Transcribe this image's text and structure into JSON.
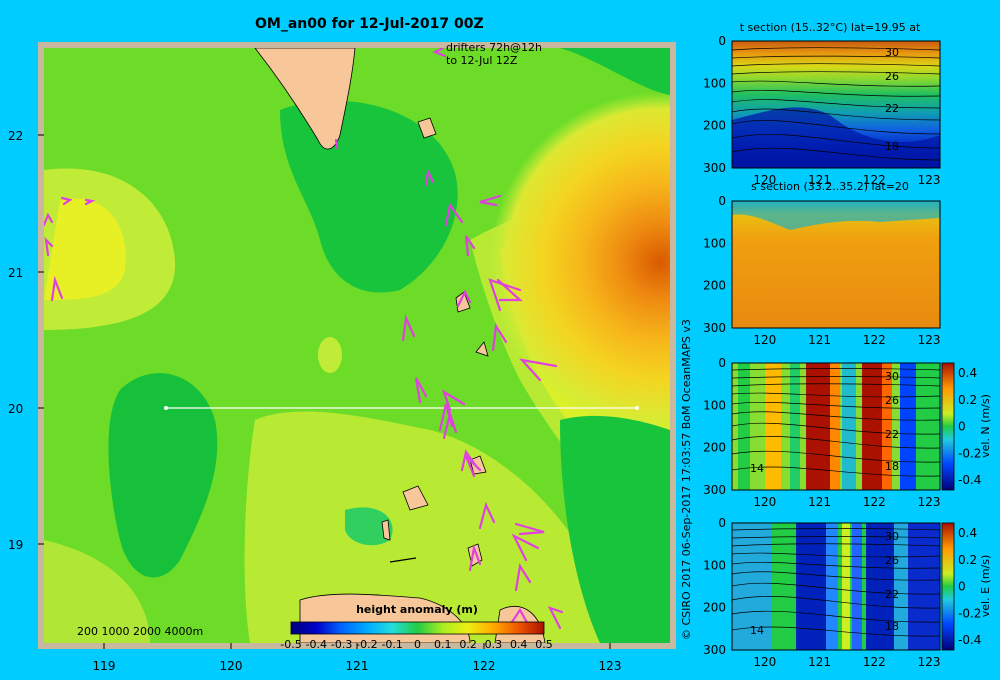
{
  "main_title": "OM_an00 for 12-Jul-2017 00Z",
  "credit": "© CSIRO 2017   06-Sep-2017 17:03:57 BoM OceanMAPS v3",
  "map": {
    "x_ticks": [
      "119",
      "120",
      "121",
      "122",
      "123"
    ],
    "y_ticks": [
      "22",
      "21",
      "20",
      "19"
    ],
    "drifter_label_1": "drifters 72h@12h",
    "drifter_label_2": "to 12-Jul 12Z",
    "depth_legend": "200  1000  2000  4000m",
    "colorbar_title": "height anomaly  (m)",
    "colorbar_ticks": [
      "-0.5",
      "-0.4",
      "-0.3",
      "-0.2",
      "-0.1",
      "0",
      "0.1",
      "0.2",
      "0.3",
      "0.4",
      "0.5"
    ],
    "colors": {
      "ocean_bg": "#00ccff",
      "land": "#f7c79a",
      "drifter": "#e040e0",
      "frame": "#c8b8a0"
    }
  },
  "panels": {
    "t_section": {
      "title": "t section (15..32°C) lat=19.95 at",
      "y_ticks": [
        "0",
        "100",
        "200",
        "300"
      ],
      "x_ticks": [
        "120",
        "121",
        "122",
        "123"
      ],
      "contour_labels": [
        "30",
        "26",
        "22",
        "18"
      ]
    },
    "s_section": {
      "title": "s section (33.2..35.2) lat=20",
      "y_ticks": [
        "0",
        "100",
        "200",
        "300"
      ],
      "x_ticks": [
        "120",
        "121",
        "122",
        "123"
      ]
    },
    "vn_section": {
      "y_ticks": [
        "0",
        "100",
        "200",
        "300"
      ],
      "x_ticks": [
        "120",
        "121",
        "122",
        "123"
      ],
      "contour_labels": [
        "30",
        "26",
        "22",
        "18",
        "14"
      ],
      "cbar_ticks": [
        "0.4",
        "0.2",
        "0",
        "-0.2",
        "-0.4"
      ],
      "cbar_label": "vel. N (m/s)"
    },
    "ve_section": {
      "y_ticks": [
        "0",
        "100",
        "200",
        "300"
      ],
      "x_ticks": [
        "120",
        "121",
        "122",
        "123"
      ],
      "contour_labels": [
        "30",
        "26",
        "22",
        "18",
        "14"
      ],
      "cbar_ticks": [
        "0.4",
        "0.2",
        "0",
        "-0.2",
        "-0.4"
      ],
      "cbar_label": "vel. E (m/s)"
    }
  },
  "chart_data": [
    {
      "type": "heatmap",
      "title": "OM_an00 for 12-Jul-2017 00Z",
      "variable": "height anomaly (m)",
      "xlim": [
        118.5,
        123.5
      ],
      "ylim": [
        18.2,
        22.7
      ],
      "colorbar_range": [
        -0.5,
        0.5
      ],
      "features": [
        {
          "name": "high",
          "lon": 123.4,
          "lat": 21.0,
          "value": 0.4
        },
        {
          "name": "low",
          "lon": 119.7,
          "lat": 19.9,
          "value": 0.0
        },
        {
          "name": "background",
          "value": 0.1
        }
      ],
      "section_line": {
        "lat": 20.0,
        "lon": [
          119.5,
          123.2
        ]
      }
    },
    {
      "type": "heatmap",
      "title": "t section (15..32°C) lat=19.95 at",
      "xlim": [
        119.6,
        123.2
      ],
      "ylim": [
        300,
        0
      ],
      "range": [
        15,
        32
      ]
    },
    {
      "type": "heatmap",
      "title": "s section (33.2..35.2) lat=20",
      "xlim": [
        119.6,
        123.2
      ],
      "ylim": [
        300,
        0
      ],
      "range": [
        33.2,
        35.2
      ]
    },
    {
      "type": "heatmap",
      "title": "vel. N (m/s)",
      "xlim": [
        119.6,
        123.2
      ],
      "ylim": [
        300,
        0
      ],
      "range": [
        -0.4,
        0.4
      ]
    },
    {
      "type": "heatmap",
      "title": "vel. E (m/s)",
      "xlim": [
        119.6,
        123.2
      ],
      "ylim": [
        300,
        0
      ],
      "range": [
        -0.4,
        0.4
      ]
    }
  ]
}
